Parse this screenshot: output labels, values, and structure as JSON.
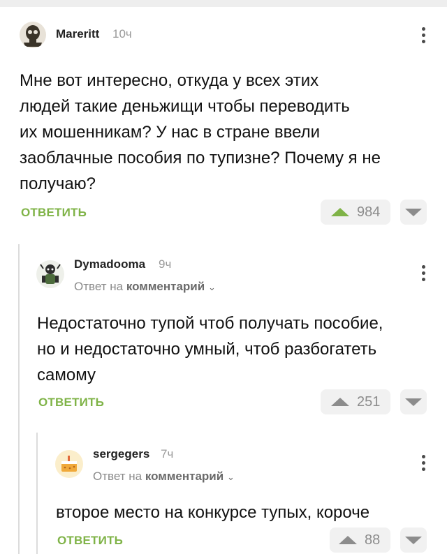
{
  "colors": {
    "accent": "#7fb347",
    "upvote_active": "#7fb347",
    "upvote_neutral": "#8c8c8c"
  },
  "comments": [
    {
      "author": "Mareritt",
      "time": "10ч",
      "text_lines": [
        "Мне вот интересно, откуда у всех этих",
        "людей такие деньжищи чтобы переводить",
        "их мошенникам? У нас в стране ввели",
        "заоблачные пособия по тупизне? Почему я не",
        "получаю?"
      ],
      "reply_label": "ОТВЕТИТЬ",
      "votes": "984",
      "avatar_icon": "skull-avatar-icon"
    },
    {
      "author": "Dymadooma",
      "time": "9ч",
      "reply_to_prefix": "Ответ на",
      "reply_to_target": "комментарий",
      "text_lines": [
        "Недостаточно тупой чтоб получать пособие,",
        "но и недостаточно умный, чтоб разбогатеть",
        "самому"
      ],
      "reply_label": "ОТВЕТИТЬ",
      "votes": "251",
      "avatar_icon": "character-avatar-icon"
    },
    {
      "author": "sergegers",
      "time": "7ч",
      "reply_to_prefix": "Ответ на",
      "reply_to_target": "комментарий",
      "text_lines": [
        "второе место на конкурсе тупых, короче"
      ],
      "reply_label": "ОТВЕТИТЬ",
      "votes": "88",
      "avatar_icon": "cake-avatar-icon"
    }
  ]
}
